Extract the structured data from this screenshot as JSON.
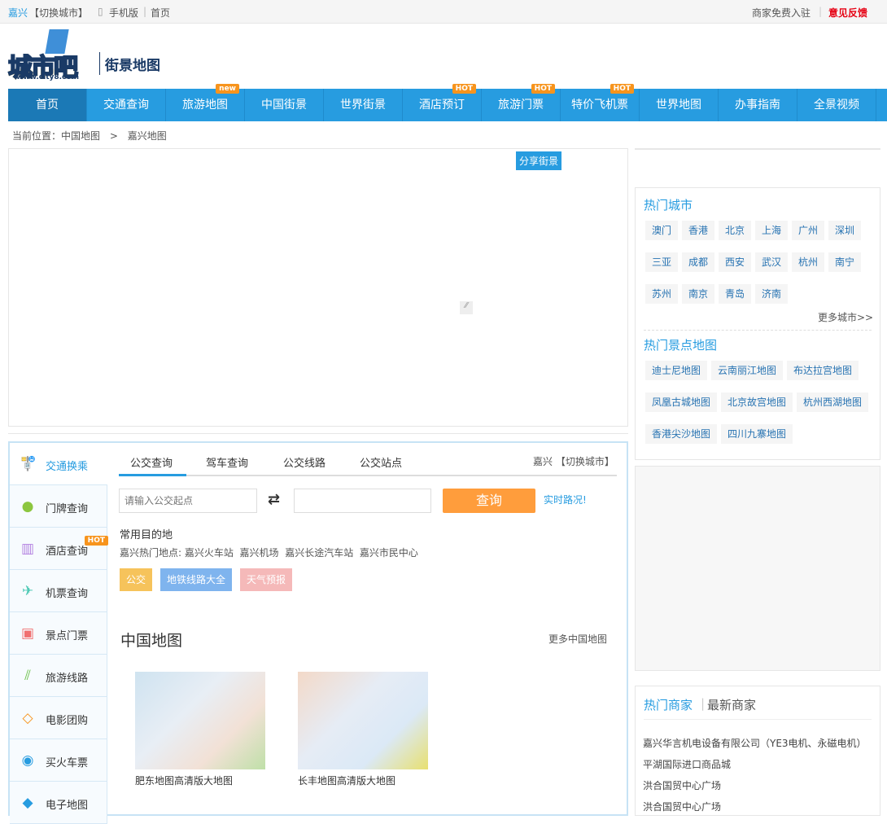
{
  "topbar": {
    "city": "嘉兴",
    "switch": "【切换城市】",
    "mobile": "手机版",
    "home": "首页",
    "merchant": "商家免费入驻",
    "feedback": "意见反馈"
  },
  "logo": {
    "text": "城市吧",
    "url_text": "www.city8.com",
    "subtitle": "街景地图"
  },
  "nav": [
    {
      "label": "首页"
    },
    {
      "label": "交通查询"
    },
    {
      "label": "旅游地图",
      "badge": "new"
    },
    {
      "label": "中国街景"
    },
    {
      "label": "世界街景"
    },
    {
      "label": "酒店预订",
      "badge": "HOT"
    },
    {
      "label": "旅游门票",
      "badge": "HOT"
    },
    {
      "label": "特价飞机票",
      "badge": "HOT"
    },
    {
      "label": "世界地图"
    },
    {
      "label": "办事指南"
    },
    {
      "label": "全景视频"
    }
  ],
  "breadcrumb": {
    "prefix": "当前位置：",
    "l1": "中国地图",
    "sep": ">",
    "l2": "嘉兴地图"
  },
  "map": {
    "share": "分享街景"
  },
  "hot_cities": {
    "title": "热门城市",
    "items": [
      "澳门",
      "香港",
      "北京",
      "上海",
      "广州",
      "深圳",
      "三亚",
      "成都",
      "西安",
      "武汉",
      "杭州",
      "南宁",
      "苏州",
      "南京",
      "青岛",
      "济南"
    ],
    "more": "更多城市>>"
  },
  "hot_spots": {
    "title": "热门景点地图",
    "items": [
      "迪士尼地图",
      "云南丽江地图",
      "布达拉宫地图",
      "凤凰古城地图",
      "北京故宫地图",
      "杭州西湖地图",
      "香港尖沙地图",
      "四川九寨地图"
    ]
  },
  "merchants": {
    "tab1": "热门商家",
    "tab2": "最新商家",
    "items": [
      "嘉兴华言机电设备有限公司（YE3电机、永磁电机）",
      "平湖国际进口商品城",
      "洪合国贸中心广场",
      "洪合国贸中心广场"
    ]
  },
  "side": [
    {
      "label": "交通换乘",
      "icon": "bus-icon"
    },
    {
      "label": "门牌查询",
      "icon": "pin-icon"
    },
    {
      "label": "酒店查询",
      "icon": "hotel-icon",
      "badge": "HOT"
    },
    {
      "label": "机票查询",
      "icon": "plane-icon"
    },
    {
      "label": "景点门票",
      "icon": "ticket-icon"
    },
    {
      "label": "旅游线路",
      "icon": "route-icon"
    },
    {
      "label": "电影团购",
      "icon": "tag-icon"
    },
    {
      "label": "买火车票",
      "icon": "train-icon"
    },
    {
      "label": "电子地图",
      "icon": "map-icon"
    }
  ],
  "tabs": [
    "公交查询",
    "驾车查询",
    "公交线路",
    "公交站点"
  ],
  "city_switch": {
    "city": "嘉兴",
    "switch": "【切换城市】"
  },
  "search": {
    "placeholder": "请输入公交起点",
    "end_value": "",
    "button": "查询",
    "realtime": "实时路况!"
  },
  "common": {
    "title": "常用目的地",
    "prefix": "嘉兴热门地点:",
    "places": [
      "嘉兴火车站",
      "嘉兴机场",
      "嘉兴长途汽车站",
      "嘉兴市民中心"
    ]
  },
  "quick": [
    "公交",
    "地铁线路大全",
    "天气预报"
  ],
  "china_map": {
    "title": "中国地图",
    "more": "更多中国地图",
    "items": [
      "肥东地图高清版大地图",
      "长丰地图高清版大地图"
    ]
  },
  "colors": {
    "brand": "#279ce0",
    "orange": "#ff9d3c",
    "red": "#e60012"
  }
}
